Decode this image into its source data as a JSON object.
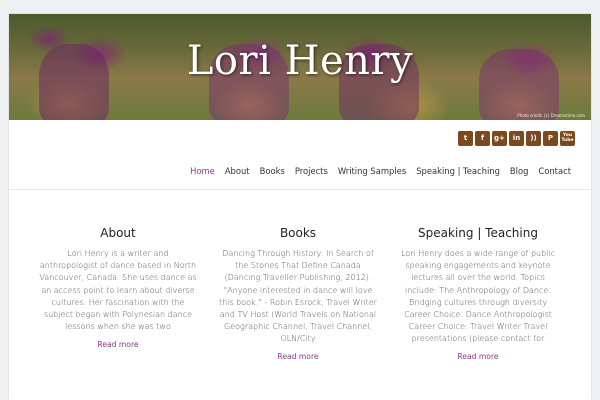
{
  "site": {
    "title": "Lori Henry",
    "photo_credit": "Photo credit: (c) Dreamstime.com"
  },
  "social": [
    {
      "name": "twitter-icon",
      "glyph": "t"
    },
    {
      "name": "facebook-icon",
      "glyph": "f"
    },
    {
      "name": "google-plus-icon",
      "glyph": "g+"
    },
    {
      "name": "linkedin-icon",
      "glyph": "in"
    },
    {
      "name": "rss-icon",
      "glyph": "))"
    },
    {
      "name": "pinterest-icon",
      "glyph": "P"
    },
    {
      "name": "youtube-icon",
      "glyph": "You Tube"
    }
  ],
  "nav": {
    "items": [
      {
        "label": "Home",
        "active": true
      },
      {
        "label": "About"
      },
      {
        "label": "Books"
      },
      {
        "label": "Projects"
      },
      {
        "label": "Writing Samples"
      },
      {
        "label": "Speaking | Teaching"
      },
      {
        "label": "Blog"
      },
      {
        "label": "Contact"
      }
    ]
  },
  "columns": [
    {
      "heading": "About",
      "body": "Lori Henry is a writer and anthropologist of dance based in North Vancouver, Canada. She uses dance as an access point to learn about diverse cultures. Her fascination with the subject began with Polynesian dance lessons when she was two",
      "more": "Read more"
    },
    {
      "heading": "Books",
      "body": "Dancing Through History: In Search of the Stories That Define Canada (Dancing Traveller Publishing, 2012). \"Anyone interested in dance will love this book.\" - Robin Esrock, Travel Writer and TV Host (World Travels on National Geographic Channel, Travel Channel, OLN/City",
      "more": "Read more"
    },
    {
      "heading": "Speaking | Teaching",
      "body": "Lori Henry does a wide range of public speaking engagements and keynote lectures all over the world. Topics include: The Anthropology of Dance: Bridging cultures through diversity Career Choice: Dance Anthropologist Career Choice: Travel Writer Travel presentations (please contact for",
      "more": "Read more"
    }
  ],
  "colors": {
    "accent": "#8b3a8f",
    "social_bg": "#7a4a1e"
  }
}
